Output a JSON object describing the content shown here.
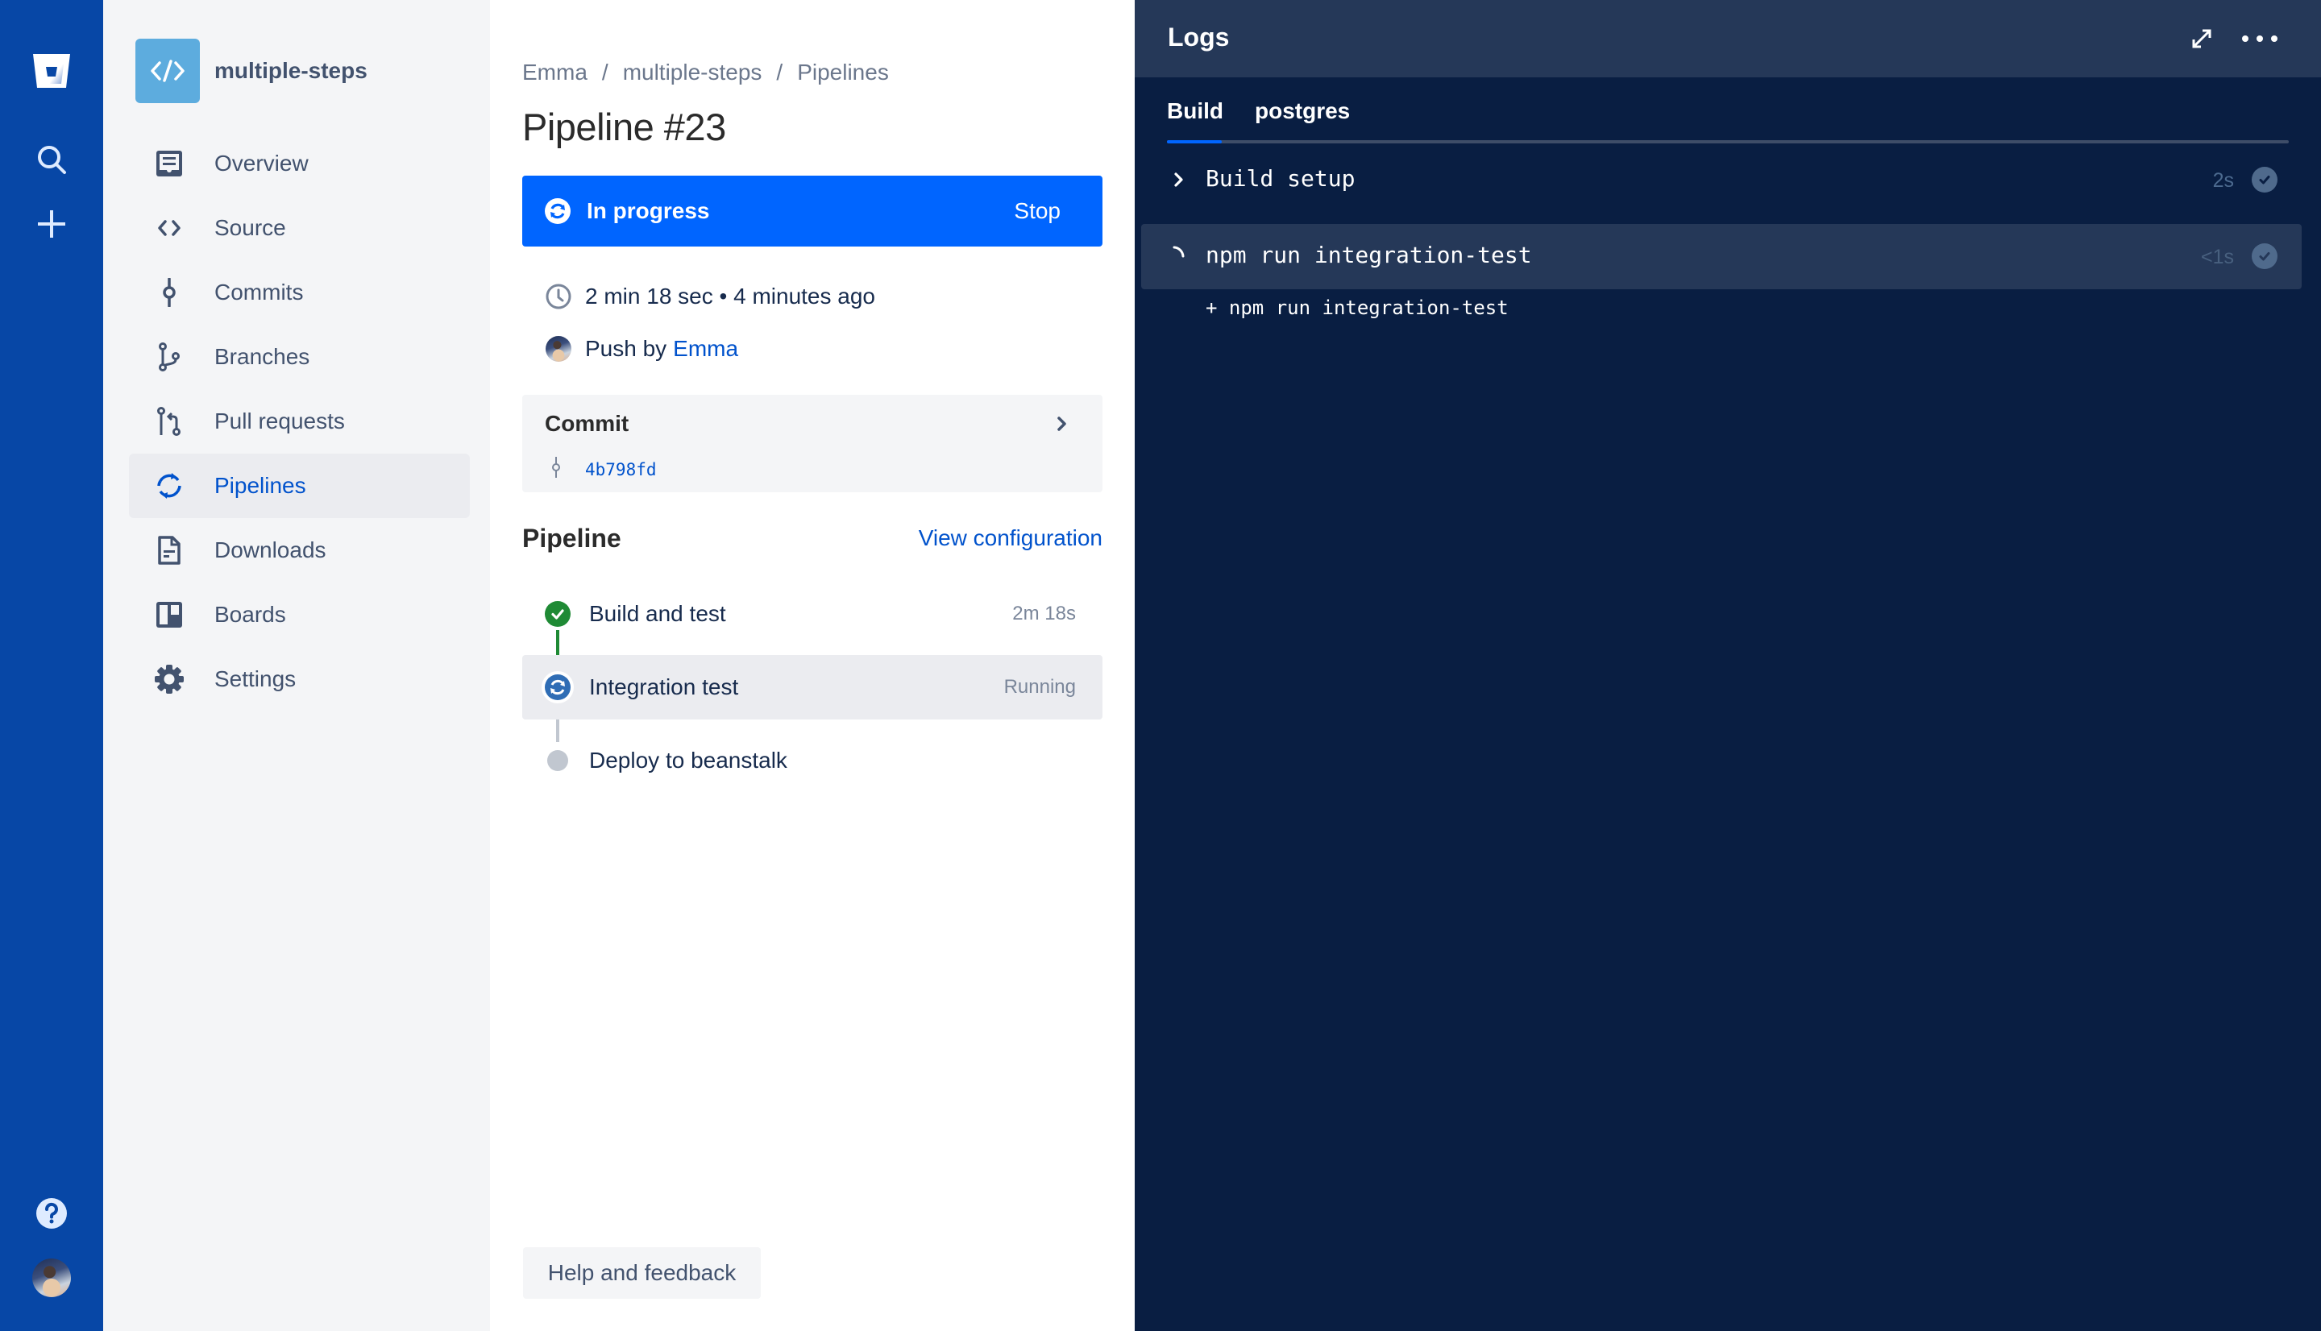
{
  "global_nav": {
    "logo_icon": "bitbucket-logo-icon",
    "search_icon": "search-icon",
    "create_icon": "plus-icon",
    "help_icon": "help-icon",
    "profile_avatar": "user-avatar"
  },
  "sidebar": {
    "repo_name": "multiple-steps",
    "repo_icon": "code-icon",
    "items": [
      {
        "label": "Overview",
        "icon": "overview-icon",
        "active": false
      },
      {
        "label": "Source",
        "icon": "source-icon",
        "active": false
      },
      {
        "label": "Commits",
        "icon": "commits-icon",
        "active": false
      },
      {
        "label": "Branches",
        "icon": "branches-icon",
        "active": false
      },
      {
        "label": "Pull requests",
        "icon": "pull-requests-icon",
        "active": false
      },
      {
        "label": "Pipelines",
        "icon": "pipelines-icon",
        "active": true
      },
      {
        "label": "Downloads",
        "icon": "downloads-icon",
        "active": false
      },
      {
        "label": "Boards",
        "icon": "boards-icon",
        "active": false
      },
      {
        "label": "Settings",
        "icon": "settings-icon",
        "active": false
      }
    ]
  },
  "main": {
    "breadcrumb": [
      "Emma",
      "multiple-steps",
      "Pipelines"
    ],
    "breadcrumb_separator": "/",
    "title": "Pipeline #23",
    "status": {
      "label": "In progress",
      "action_label": "Stop",
      "color": "#0065FF"
    },
    "duration_text": "2 min 18 sec • 4 minutes ago",
    "push_prefix": "Push by",
    "push_author": "Emma",
    "commit": {
      "title": "Commit",
      "hash": "4b798fd"
    },
    "pipeline_section_title": "Pipeline",
    "view_configuration_label": "View configuration",
    "steps": [
      {
        "label": "Build and test",
        "meta": "2m 18s",
        "status": "success",
        "status_color": "#1F8A35"
      },
      {
        "label": "Integration test",
        "meta": "Running",
        "status": "running",
        "status_color": "#2F6DB5"
      },
      {
        "label": "Deploy to beanstalk",
        "meta": "",
        "status": "pending",
        "status_color": "#C1C7D0"
      }
    ],
    "help_feedback_label": "Help and feedback"
  },
  "logs": {
    "title": "Logs",
    "tabs": [
      {
        "label": "Build",
        "active": true
      },
      {
        "label": "postgres",
        "active": false
      }
    ],
    "steps": [
      {
        "label": "Build setup",
        "duration": "2s",
        "state": "collapsed",
        "done": true
      },
      {
        "label": "npm run integration-test",
        "duration": "<1s",
        "state": "running",
        "done": true
      }
    ],
    "lines": [
      "+ npm run integration-test"
    ]
  }
}
